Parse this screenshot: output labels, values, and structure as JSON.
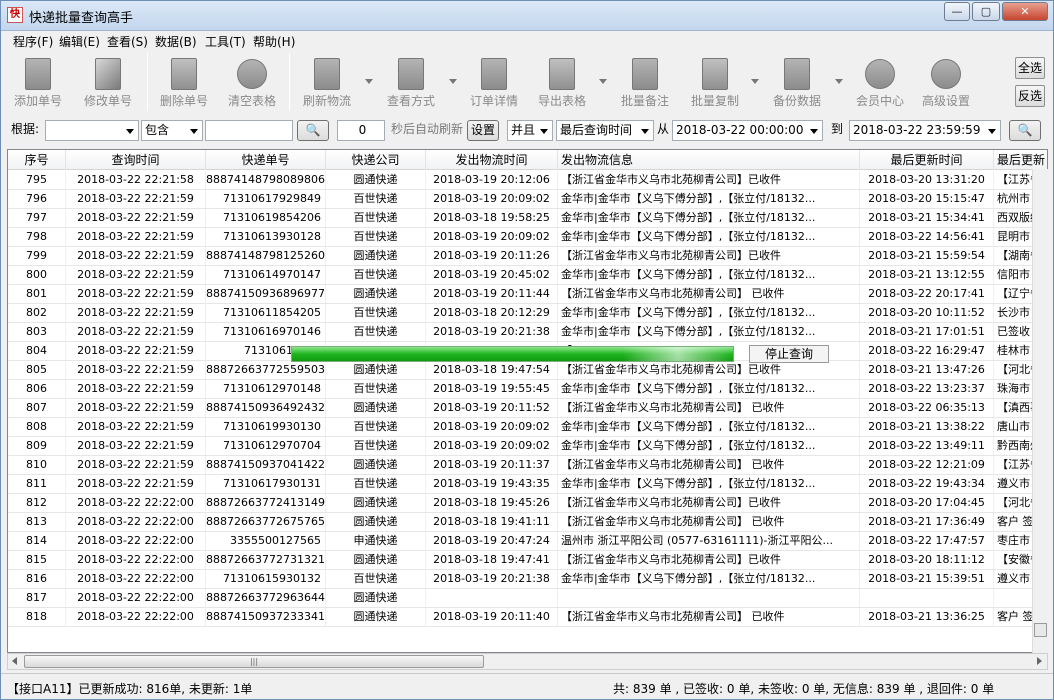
{
  "window": {
    "title": "快递批量查询高手",
    "min_icon": "minimize-icon",
    "max_icon": "maximize-icon",
    "close_icon": "close-icon"
  },
  "menu": [
    "程序(F)",
    "编辑(E)",
    "查看(S)",
    "数据(B)",
    "工具(T)",
    "帮助(H)"
  ],
  "toolbar": [
    {
      "label": "添加单号",
      "icon": "add-document-icon"
    },
    {
      "label": "修改单号",
      "icon": "edit-document-icon"
    },
    {
      "label": "删除单号",
      "icon": "delete-document-icon"
    },
    {
      "label": "清空表格",
      "icon": "clear-table-icon"
    },
    {
      "label": "刷新物流",
      "icon": "refresh-icon"
    },
    {
      "label": "查看方式",
      "icon": "view-mode-icon"
    },
    {
      "label": "订单详情",
      "icon": "order-detail-icon"
    },
    {
      "label": "导出表格",
      "icon": "export-icon"
    },
    {
      "label": "批量备注",
      "icon": "note-icon"
    },
    {
      "label": "批量复制",
      "icon": "copy-icon"
    },
    {
      "label": "备份数据",
      "icon": "backup-icon"
    },
    {
      "label": "会员中心",
      "icon": "clock-icon"
    },
    {
      "label": "高级设置",
      "icon": "settings-icon"
    }
  ],
  "side_buttons": {
    "select_all": "全选",
    "invert": "反选"
  },
  "filter": {
    "root_label": "根据:",
    "field_value": "",
    "match_value": "包含",
    "keyword_value": "",
    "refresh_seconds": "0",
    "auto_refresh_label": "秒后自动刷新",
    "settings_label": "设置",
    "logic_value": "并且",
    "time_field_value": "最后查询时间",
    "from_label": "从",
    "from_value": "2018-03-22 00:00:00",
    "to_label": "到",
    "to_value": "2018-03-22 23:59:59"
  },
  "columns": [
    "序号",
    "查询时间",
    "快递单号",
    "快递公司",
    "发出物流时间",
    "发出物流信息",
    "最后更新时间",
    "最后更新"
  ],
  "rows": [
    [
      "795",
      "2018-03-22 22:21:58",
      "888741487980898067",
      "圆通快递",
      "2018-03-19 20:12:06",
      "【浙江省金华市义乌市北苑柳青公司】已收件",
      "2018-03-20 13:31:20",
      "【江苏省"
    ],
    [
      "796",
      "2018-03-22 22:21:59",
      "71310617929849",
      "百世快递",
      "2018-03-19 20:09:02",
      "金华市|金华市【义乌下傅分部】,【张立付/18132...",
      "2018-03-20 15:15:47",
      "杭州市"
    ],
    [
      "797",
      "2018-03-22 22:21:59",
      "71310619854206",
      "百世快递",
      "2018-03-18 19:58:25",
      "金华市|金华市【义乌下傅分部】,【张立付/18132...",
      "2018-03-21 15:34:41",
      "西双版纳"
    ],
    [
      "798",
      "2018-03-22 22:21:59",
      "71310613930128",
      "百世快递",
      "2018-03-19 20:09:02",
      "金华市|金华市【义乌下傅分部】,【张立付/18132...",
      "2018-03-22 14:56:41",
      "昆明市"
    ],
    [
      "799",
      "2018-03-22 22:21:59",
      "888741487981252603",
      "圆通快递",
      "2018-03-19 20:11:26",
      "【浙江省金华市义乌市北苑柳青公司】已收件",
      "2018-03-21 15:59:54",
      "【湖南省"
    ],
    [
      "800",
      "2018-03-22 22:21:59",
      "71310614970147",
      "百世快递",
      "2018-03-19 20:45:02",
      "金华市|金华市【义乌下傅分部】,【张立付/18132...",
      "2018-03-21 13:12:55",
      "信阳市"
    ],
    [
      "801",
      "2018-03-22 22:21:59",
      "888741509368969774",
      "圆通快递",
      "2018-03-19 20:11:44",
      "【浙江省金华市义乌市北苑柳青公司】 已收件",
      "2018-03-22 20:17:41",
      "【辽宁省"
    ],
    [
      "802",
      "2018-03-22 22:21:59",
      "71310611854205",
      "百世快递",
      "2018-03-18 20:12:29",
      "金华市|金华市【义乌下傅分部】,【张立付/18132...",
      "2018-03-20 10:11:52",
      "长沙市"
    ],
    [
      "803",
      "2018-03-22 22:21:59",
      "71310616970146",
      "百世快递",
      "2018-03-19 20:21:38",
      "金华市|金华市【义乌下傅分部】,【张立付/18132...",
      "2018-03-21 17:01:51",
      "已签收"
    ],
    [
      "804",
      "2018-03-22 22:21:59",
      "71310611930",
      "",
      "",
      "【",
      "2018-03-22 16:29:47",
      "桂林市"
    ],
    [
      "805",
      "2018-03-22 22:21:59",
      "888726637725595037",
      "圆通快递",
      "2018-03-18 19:47:54",
      "【浙江省金华市义乌市北苑柳青公司】已收件",
      "2018-03-21 13:47:26",
      "【河北省"
    ],
    [
      "806",
      "2018-03-22 22:21:59",
      "71310612970148",
      "百世快递",
      "2018-03-19 19:55:45",
      "金华市|金华市【义乌下傅分部】,【张立付/18132...",
      "2018-03-22 13:23:37",
      "珠海市"
    ],
    [
      "807",
      "2018-03-22 22:21:59",
      "888741509364924320",
      "圆通快递",
      "2018-03-19 20:11:52",
      "【浙江省金华市义乌市北苑柳青公司】 已收件",
      "2018-03-22 06:35:13",
      "【滇西事"
    ],
    [
      "808",
      "2018-03-22 22:21:59",
      "71310619930130",
      "百世快递",
      "2018-03-19 20:09:02",
      "金华市|金华市【义乌下傅分部】,【张立付/18132...",
      "2018-03-21 13:38:22",
      "唐山市"
    ],
    [
      "809",
      "2018-03-22 22:21:59",
      "71310612970704",
      "百世快递",
      "2018-03-19 20:09:02",
      "金华市|金华市【义乌下傅分部】,【张立付/18132...",
      "2018-03-22 13:49:11",
      "黔西南州"
    ],
    [
      "810",
      "2018-03-22 22:21:59",
      "888741509370414229",
      "圆通快递",
      "2018-03-19 20:11:37",
      "【浙江省金华市义乌市北苑柳青公司】 已收件",
      "2018-03-22 12:21:09",
      "【江苏省"
    ],
    [
      "811",
      "2018-03-22 22:21:59",
      "71310617930131",
      "百世快递",
      "2018-03-19 19:43:35",
      "金华市|金华市【义乌下傅分部】,【张立付/18132...",
      "2018-03-22 19:43:34",
      "遵义市"
    ],
    [
      "812",
      "2018-03-22 22:22:00",
      "888726637724131491",
      "圆通快递",
      "2018-03-18 19:45:26",
      "【浙江省金华市义乌市北苑柳青公司】已收件",
      "2018-03-20 17:04:45",
      "【河北省"
    ],
    [
      "813",
      "2018-03-22 22:22:00",
      "888726637726757653",
      "圆通快递",
      "2018-03-18 19:41:11",
      "【浙江省金华市义乌市北苑柳青公司】 已收件",
      "2018-03-21 17:36:49",
      "客户 签"
    ],
    [
      "814",
      "2018-03-22 22:22:00",
      "3355500127565",
      "申通快递",
      "2018-03-19 20:47:24",
      "温州市 浙江平阳公司 (0577-63161111)-浙江平阳公...",
      "2018-03-22 17:47:57",
      "枣庄市"
    ],
    [
      "815",
      "2018-03-22 22:22:00",
      "888726637727313219",
      "圆通快递",
      "2018-03-18 19:47:41",
      "【浙江省金华市义乌市北苑柳青公司】已收件",
      "2018-03-20 18:11:12",
      "【安徽省"
    ],
    [
      "816",
      "2018-03-22 22:22:00",
      "71310615930132",
      "百世快递",
      "2018-03-19 20:21:38",
      "金华市|金华市【义乌下傅分部】,【张立付/18132...",
      "2018-03-21 15:39:51",
      "遵义市"
    ],
    [
      "817",
      "2018-03-22 22:22:00",
      "888726637729636441",
      "圆通快递",
      "",
      "",
      "",
      ""
    ],
    [
      "818",
      "2018-03-22 22:22:00",
      "888741509372333411",
      "圆通快递",
      "2018-03-19 20:11:40",
      "【浙江省金华市义乌市北苑柳青公司】 已收件",
      "2018-03-21 13:36:25",
      "客户 签"
    ]
  ],
  "progress": {
    "fraction": 0.82,
    "stop_label": "停止查询"
  },
  "status": {
    "left": "【接口A11】已更新成功: 816单, 未更新: 1单",
    "right": "共: 839 单 , 已签收: 0 单, 未签收: 0 单, 无信息: 839 单 , 退回件: 0 单"
  }
}
